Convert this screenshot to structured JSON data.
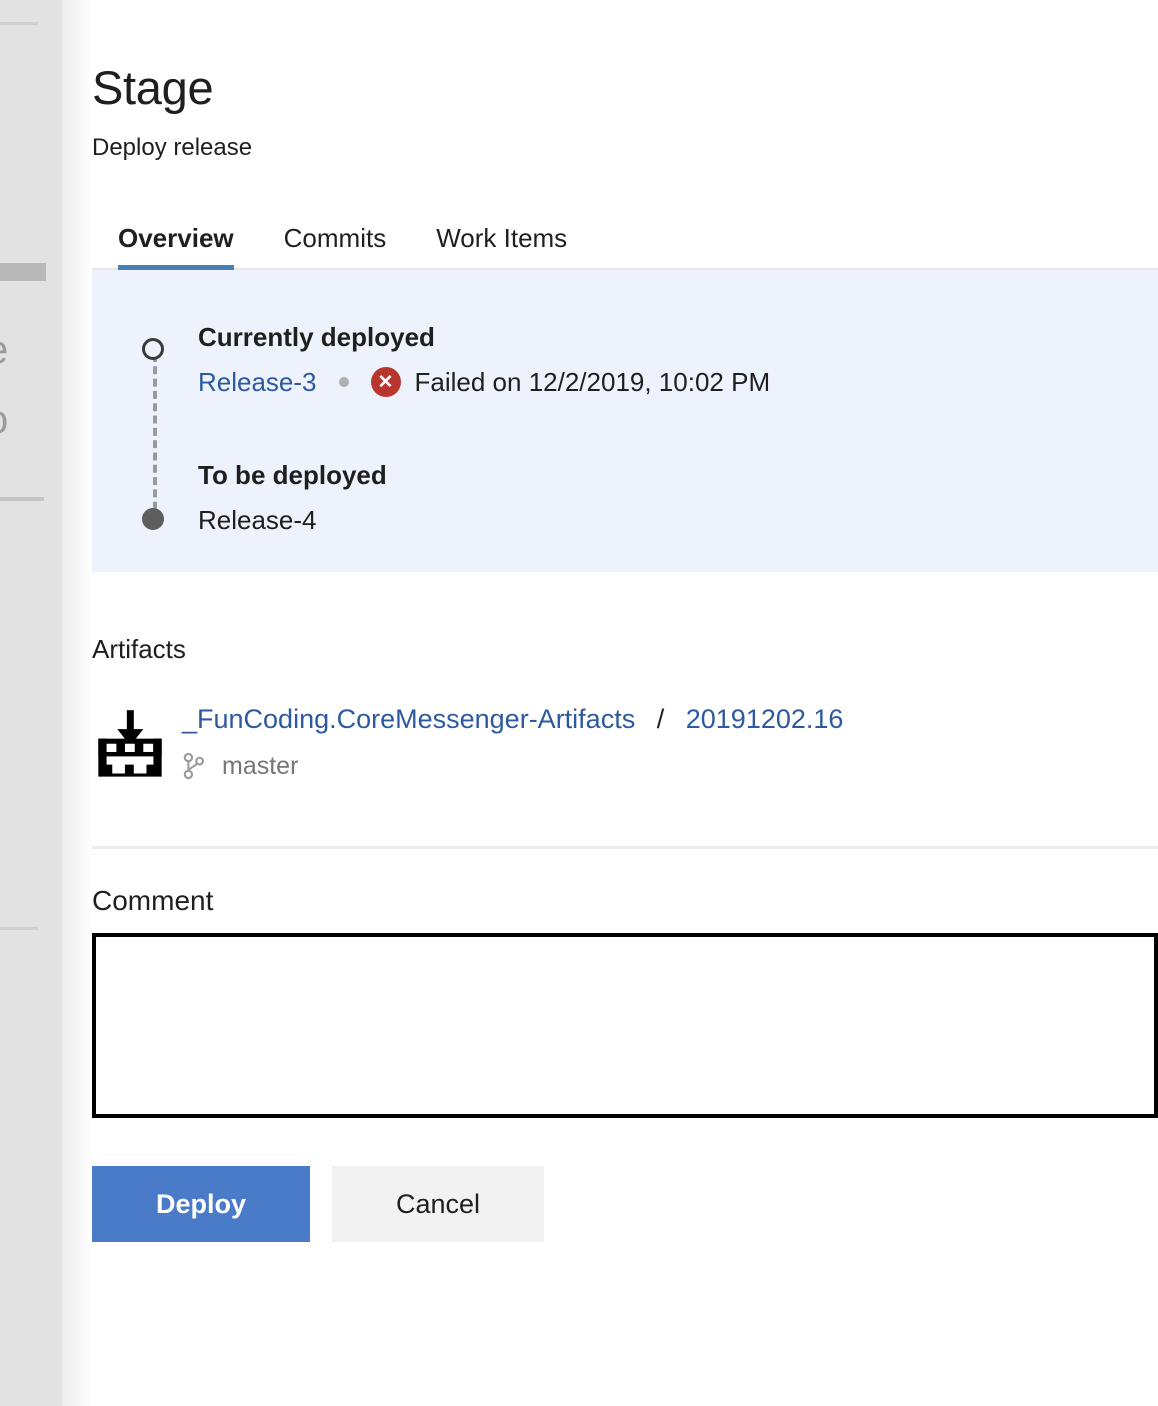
{
  "background": {
    "fragment_top": "e",
    "fragment_bottom": "o"
  },
  "header": {
    "title": "Stage",
    "subtitle": "Deploy release"
  },
  "tabs": [
    {
      "label": "Overview",
      "active": true
    },
    {
      "label": "Commits",
      "active": false
    },
    {
      "label": "Work Items",
      "active": false
    }
  ],
  "deployment": {
    "current": {
      "heading": "Currently deployed",
      "release": "Release-3",
      "status_icon": "error-circle-icon",
      "status_text": "Failed on 12/2/2019, 10:02 PM"
    },
    "next": {
      "heading": "To be deployed",
      "release": "Release-4"
    }
  },
  "artifacts": {
    "title": "Artifacts",
    "icon": "build-artifact-icon",
    "name": "_FunCoding.CoreMessenger-Artifacts",
    "separator": "/",
    "version": "20191202.16",
    "branch_icon": "branch-icon",
    "branch": "master"
  },
  "comment": {
    "label": "Comment",
    "value": "",
    "placeholder": ""
  },
  "actions": {
    "deploy_label": "Deploy",
    "cancel_label": "Cancel"
  },
  "colors": {
    "accent": "#4a7bc8",
    "tab_underline": "#4a7ebb",
    "link": "#2d5a9e",
    "panel_bg": "#eef2fc",
    "error": "#b8362e"
  }
}
